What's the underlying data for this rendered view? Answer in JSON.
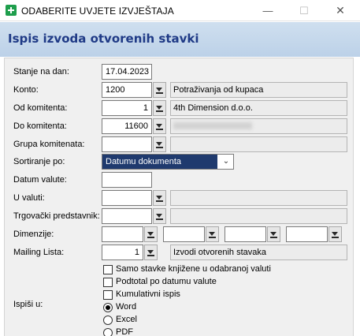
{
  "window": {
    "title": "ODABERITE UVJETE IZVJEŠTAJA",
    "min_glyph": "—",
    "max_glyph": "☐",
    "close_glyph": "✕"
  },
  "header": {
    "title": "Ispis izvoda otvorenih stavki"
  },
  "form": {
    "stanje_na_dan": {
      "label": "Stanje na dan:",
      "value": "17.04.2023"
    },
    "konto": {
      "label": "Konto:",
      "value": "1200",
      "desc": "Potraživanja od kupaca"
    },
    "od_komitenta": {
      "label": "Od komitenta:",
      "value": "1",
      "desc": "4th Dimension d.o.o."
    },
    "do_komitenta": {
      "label": "Do komitenta:",
      "value": "11600",
      "desc": ""
    },
    "grupa_komitenata": {
      "label": "Grupa komitenata:",
      "value": "",
      "desc": ""
    },
    "sortiranje_po": {
      "label": "Sortiranje po:",
      "value": "Datumu dokumenta"
    },
    "datum_valute": {
      "label": "Datum valute:",
      "value": ""
    },
    "u_valuti": {
      "label": "U valuti:",
      "value": "",
      "desc": ""
    },
    "trgovacki_predstavnik": {
      "label": "Trgovački predstavnik:",
      "value": "",
      "desc": ""
    },
    "dimenzije": {
      "label": "Dimenzije:",
      "values": [
        "",
        "",
        "",
        ""
      ]
    },
    "mailing_lista": {
      "label": "Mailing Lista:",
      "value": "1",
      "desc": "Izvodi otvorenih stavaka"
    },
    "checkboxes": [
      {
        "label": "Samo stavke knjižene u odabranoj valuti",
        "checked": false
      },
      {
        "label": "Podtotal po datumu valute",
        "checked": false
      },
      {
        "label": "Kumulativni ispis",
        "checked": false
      }
    ],
    "ispisi_u": {
      "label": "Ispiši u:",
      "options": [
        {
          "label": "Word",
          "selected": true
        },
        {
          "label": "Excel",
          "selected": false
        },
        {
          "label": "PDF",
          "selected": false
        }
      ]
    }
  },
  "icons": {
    "lookup": "lookup-arrow-icon",
    "dropdown": "chevron-down-icon",
    "app": "app-logo-icon"
  },
  "colors": {
    "header_title": "#1f3a86",
    "selection": "#1f3a6e",
    "app_icon": "#1e9e4c"
  }
}
